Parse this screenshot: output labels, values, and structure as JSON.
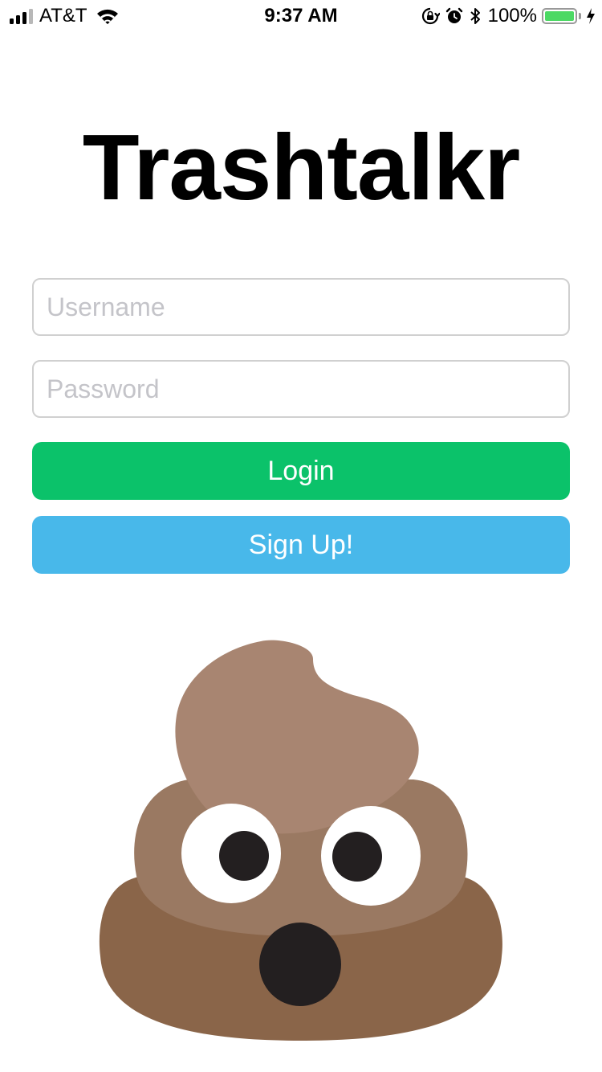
{
  "status_bar": {
    "carrier": "AT&T",
    "time": "9:37 AM",
    "battery_percent": "100%",
    "signal_bars_active": 3,
    "signal_bars_total": 4,
    "icons": [
      "signal-icon",
      "wifi-icon",
      "rotation-lock-icon",
      "alarm-icon",
      "bluetooth-icon",
      "battery-icon",
      "charging-icon"
    ]
  },
  "app": {
    "title": "Trashtalkr"
  },
  "login_form": {
    "username_placeholder": "Username",
    "username_value": "",
    "password_placeholder": "Password",
    "password_value": "",
    "login_label": "Login",
    "signup_label": "Sign Up!"
  },
  "mascot": {
    "icon": "poop-emoji-icon"
  },
  "colors": {
    "login_button": "#0bc26a",
    "signup_button": "#48b8ea",
    "battery_fill": "#4cd964",
    "poop_top": "#a88571",
    "poop_middle": "#9a7962",
    "poop_bottom": "#8a6549",
    "eye_pupil": "#231f20"
  }
}
